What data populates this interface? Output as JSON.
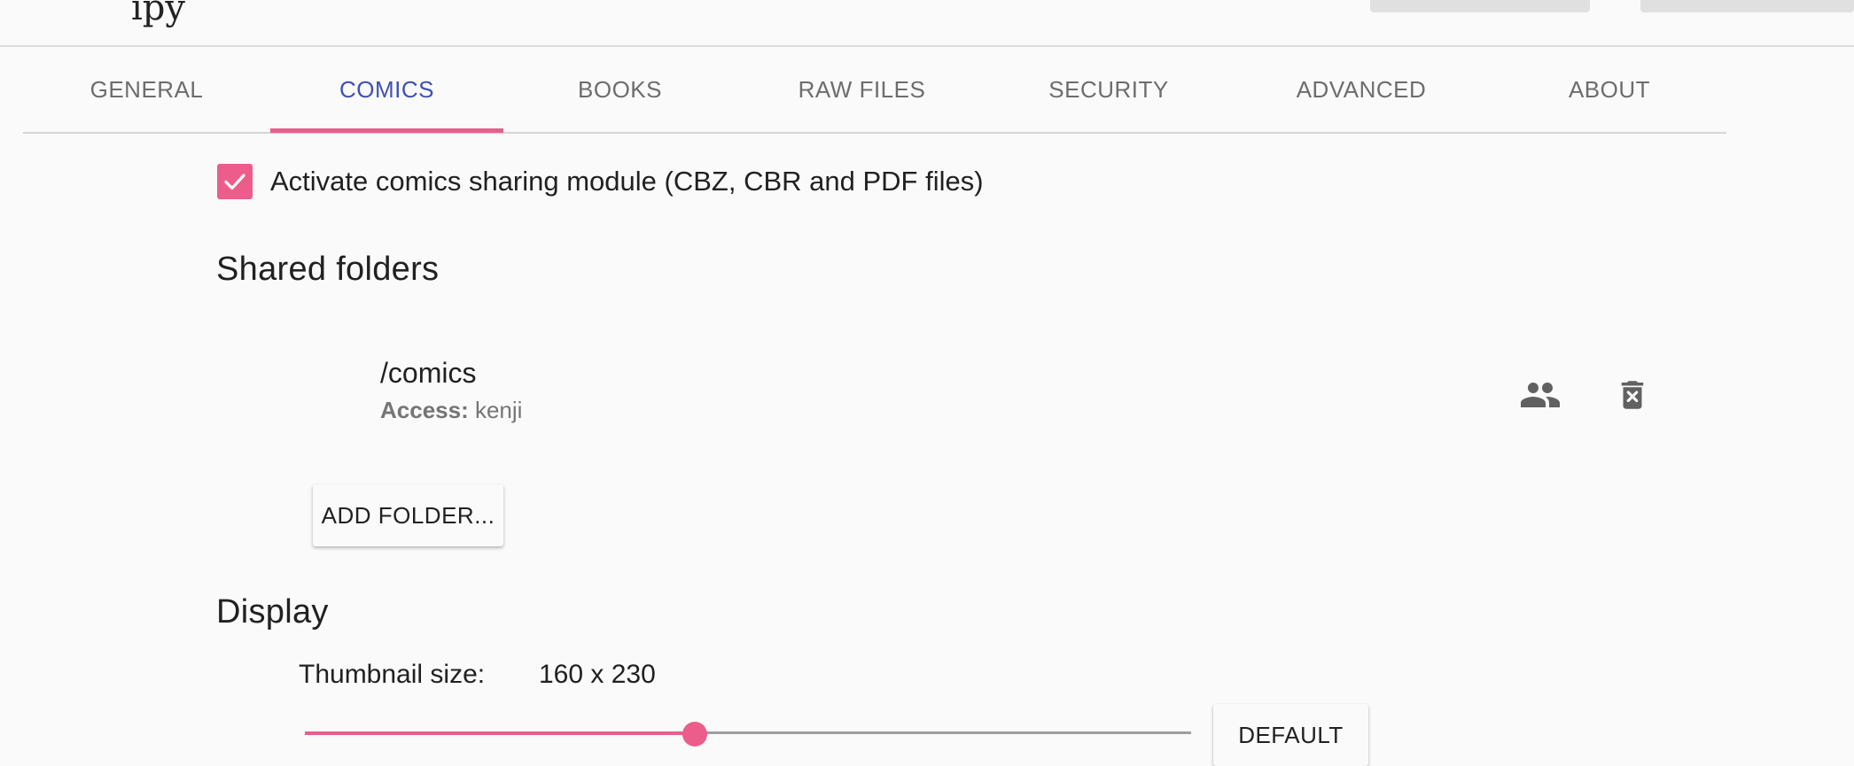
{
  "logo_fragment": "ıpy",
  "tabs": [
    {
      "label": "GENERAL"
    },
    {
      "label": "COMICS"
    },
    {
      "label": "BOOKS"
    },
    {
      "label": "RAW FILES"
    },
    {
      "label": "SECURITY"
    },
    {
      "label": "ADVANCED"
    },
    {
      "label": "ABOUT"
    }
  ],
  "active_tab": "COMICS",
  "colors": {
    "accent": "#ec5d8c",
    "active_tab_text": "#3f51b5",
    "inactive_tab_text": "#6d6d6d",
    "background": "#fafafa"
  },
  "comics_module": {
    "checked": true,
    "label": "Activate comics sharing module (CBZ, CBR and PDF files)"
  },
  "shared_folders": {
    "title": "Shared folders",
    "items": [
      {
        "path": "/comics",
        "access_label": "Access:",
        "access_value": "kenji",
        "icons": [
          "people-icon",
          "delete-icon"
        ]
      }
    ],
    "add_button_label": "ADD FOLDER..."
  },
  "display": {
    "title": "Display",
    "thumbnail_size_label": "Thumbnail size:",
    "thumbnail_size_value": "160 x 230",
    "slider_fraction": 0.44,
    "default_button_label": "DEFAULT"
  }
}
